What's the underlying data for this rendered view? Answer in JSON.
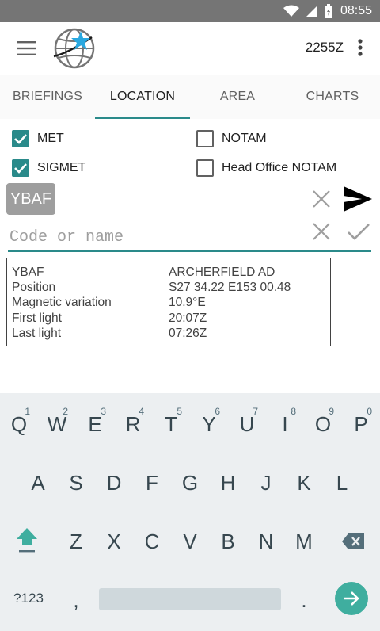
{
  "status_bar": {
    "time": "08:55"
  },
  "app_bar": {
    "zulu_time": "2255Z"
  },
  "tabs": [
    {
      "label": "BRIEFINGS",
      "active": false
    },
    {
      "label": "LOCATION",
      "active": true
    },
    {
      "label": "AREA",
      "active": false
    },
    {
      "label": "CHARTS",
      "active": false
    }
  ],
  "options": {
    "met": {
      "label": "MET",
      "checked": true
    },
    "notam": {
      "label": "NOTAM",
      "checked": false
    },
    "sigmet": {
      "label": "SIGMET",
      "checked": true
    },
    "head_office_notam": {
      "label": "Head Office NOTAM",
      "checked": false
    }
  },
  "location_chip": "YBAF",
  "search": {
    "placeholder": "Code or name",
    "value": ""
  },
  "info": {
    "rows": [
      {
        "key": "YBAF",
        "value": "ARCHERFIELD AD"
      },
      {
        "key": "Position",
        "value": "S27 34.22 E153 00.48"
      },
      {
        "key": "Magnetic variation",
        "value": "10.9°E"
      },
      {
        "key": "First light",
        "value": "20:07Z"
      },
      {
        "key": "Last light",
        "value": "07:26Z"
      }
    ]
  },
  "keyboard": {
    "row1": [
      "Q",
      "W",
      "E",
      "R",
      "T",
      "Y",
      "U",
      "I",
      "O",
      "P"
    ],
    "row1_hints": [
      "1",
      "2",
      "3",
      "4",
      "5",
      "6",
      "7",
      "8",
      "9",
      "0"
    ],
    "row2": [
      "A",
      "S",
      "D",
      "F",
      "G",
      "H",
      "J",
      "K",
      "L"
    ],
    "row3": [
      "Z",
      "X",
      "C",
      "V",
      "B",
      "N",
      "M"
    ],
    "symbols_key": "?123",
    "comma_key": ",",
    "period_key": "."
  },
  "colors": {
    "accent": "#2a8a8a",
    "enter": "#3fae9f",
    "status_bar": "#757575"
  }
}
